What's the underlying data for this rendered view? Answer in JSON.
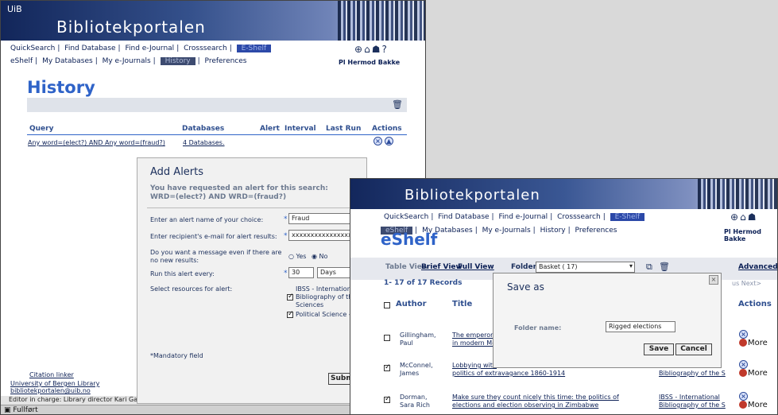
{
  "win1": {
    "uib": "UiB",
    "portal_title": "Bibliotekportalen",
    "nav1": [
      "QuickSearch",
      "Find Database",
      "Find e-Journal",
      "Crosssearch"
    ],
    "nav1_selected": "E-Shelf",
    "nav2": [
      "eShelf",
      "My Databases",
      "My e-Journals"
    ],
    "nav2_selected": "History",
    "nav2_last": "Preferences",
    "user": "Pl Hermod Bakke",
    "page_title": "History",
    "table_headers": {
      "query": "Query",
      "databases": "Databases",
      "alert": "Alert",
      "interval": "Interval",
      "last_run": "Last Run",
      "actions": "Actions"
    },
    "row": {
      "query": "Any word=(elect?) AND Any word=(fraud?)",
      "databases": "4 Databases."
    },
    "citation_linker": "Citation linker",
    "footer_line1": "University of Bergen Library",
    "footer_line2": "bibliotekportalen@uib.no",
    "editor": "Editor in charge: Library director Kari Garnes",
    "status": "Fullført",
    "dialog": {
      "title": "Add Alerts",
      "msg1": "You have requested an alert for this search:",
      "msg2": "WRD=(elect?) AND WRD=(fraud?)",
      "label_name": "Enter an alert name of your choice:",
      "value_name": "Fraud",
      "label_email": "Enter recipient's e-mail for alert results:",
      "value_email": "xxxxxxxxxxxxxxxxx",
      "label_nonew": "Do you want a message even if there are no new results:",
      "opt_yes": "Yes",
      "opt_no": "No",
      "label_every": "Run this alert every:",
      "value_every": "30",
      "value_unit": "Days",
      "label_resources": "Select resources for alert:",
      "res1": "IBSS - International",
      "res2a": "Bibliography of the",
      "res2b": "Sciences",
      "res3": "Political Science - ...",
      "mandatory": "*Mandatory field",
      "submit": "Submit"
    }
  },
  "win2": {
    "portal_title": "Bibliotekportalen",
    "nav1": [
      "QuickSearch",
      "Find Database",
      "Find e-Journal",
      "Crosssearch"
    ],
    "nav1_selected": "E-Shelf",
    "nav2_selected": "eShelf",
    "nav2": [
      "My Databases",
      "My e-Journals",
      "History",
      "Preferences"
    ],
    "user": "Pl Hermod Bakke",
    "page_title": "eShelf",
    "views": {
      "table": "Table View",
      "brief": "Brief View",
      "full": "Full View"
    },
    "folder_label": "Folder:",
    "folder_value": "Basket ( 17)",
    "advanced": "Advanced",
    "records": "1- 17 of 17 Records",
    "nav_frag": "us  Next>",
    "col_author": "Author",
    "col_title": "Title",
    "col_actions": "Actions",
    "rows": [
      {
        "author1": "Gillingham,",
        "author2": "Paul",
        "title1": "The emperor",
        "title2": "in modern Me",
        "source": "",
        "checked": false
      },
      {
        "author1": "McConnel,",
        "author2": "James",
        "title1": "Lobbying with",
        "title2": "politics of extravagance 1860-1914",
        "source": "Bibliography of the S",
        "checked": true
      },
      {
        "author1": "Dorman,",
        "author2": "Sara Rich",
        "title1": "Make sure they count nicely this time: the politics of",
        "title2": "elections and election observing in Zimbabwe",
        "source1": "IBSS - International",
        "source": "Bibliography of the S",
        "checked": true
      }
    ],
    "more": "More",
    "save_dialog": {
      "title": "Save as",
      "label": "Folder name:",
      "value": "Rigged elections",
      "save": "Save",
      "cancel": "Cancel"
    }
  }
}
